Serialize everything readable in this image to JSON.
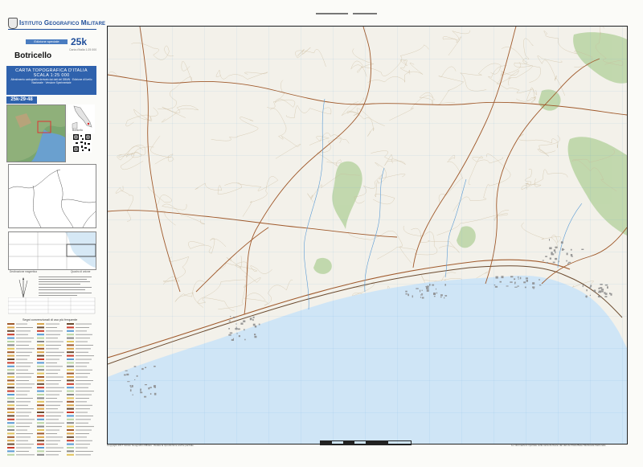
{
  "header": {
    "institute": "Istituto Geografico Militare",
    "edition": "Edizione speciale",
    "logo": "25k",
    "logo_caption": "Carta d'Italia 1:25 000"
  },
  "sheet": {
    "name": "Botricello",
    "code": "25k-29-48"
  },
  "series": {
    "line1": "CARTA TOPOGRAFICA D'ITALIA",
    "line2": "SCALA 1:25 000",
    "details": "Allestimento cartografico derivato dai dati del DBMN · Edizione di livello Nazionale · Versione Sperimentale"
  },
  "insets": {
    "location_label": "Botricello",
    "grid_caption": "Quadro di unione",
    "declination_caption": "Declinazione magnetica"
  },
  "legend": {
    "title": "Segni convenzionali di uso più frequente"
  },
  "map": {
    "sea_color": "#cfe5f6",
    "land_color": "#f3f1ea",
    "road_color": "#a05a2c",
    "urban_color": "#8a8a8a",
    "vegetation_color": "#b9d4a3"
  },
  "credits": {
    "left": "Copyright 2017 Istituto Geografico Militare. Vietata la riproduzione anche parziale.",
    "right": "Le informazioni riportate sulla carta derivano dai dati del Data Base Multiscala Nazionale."
  }
}
